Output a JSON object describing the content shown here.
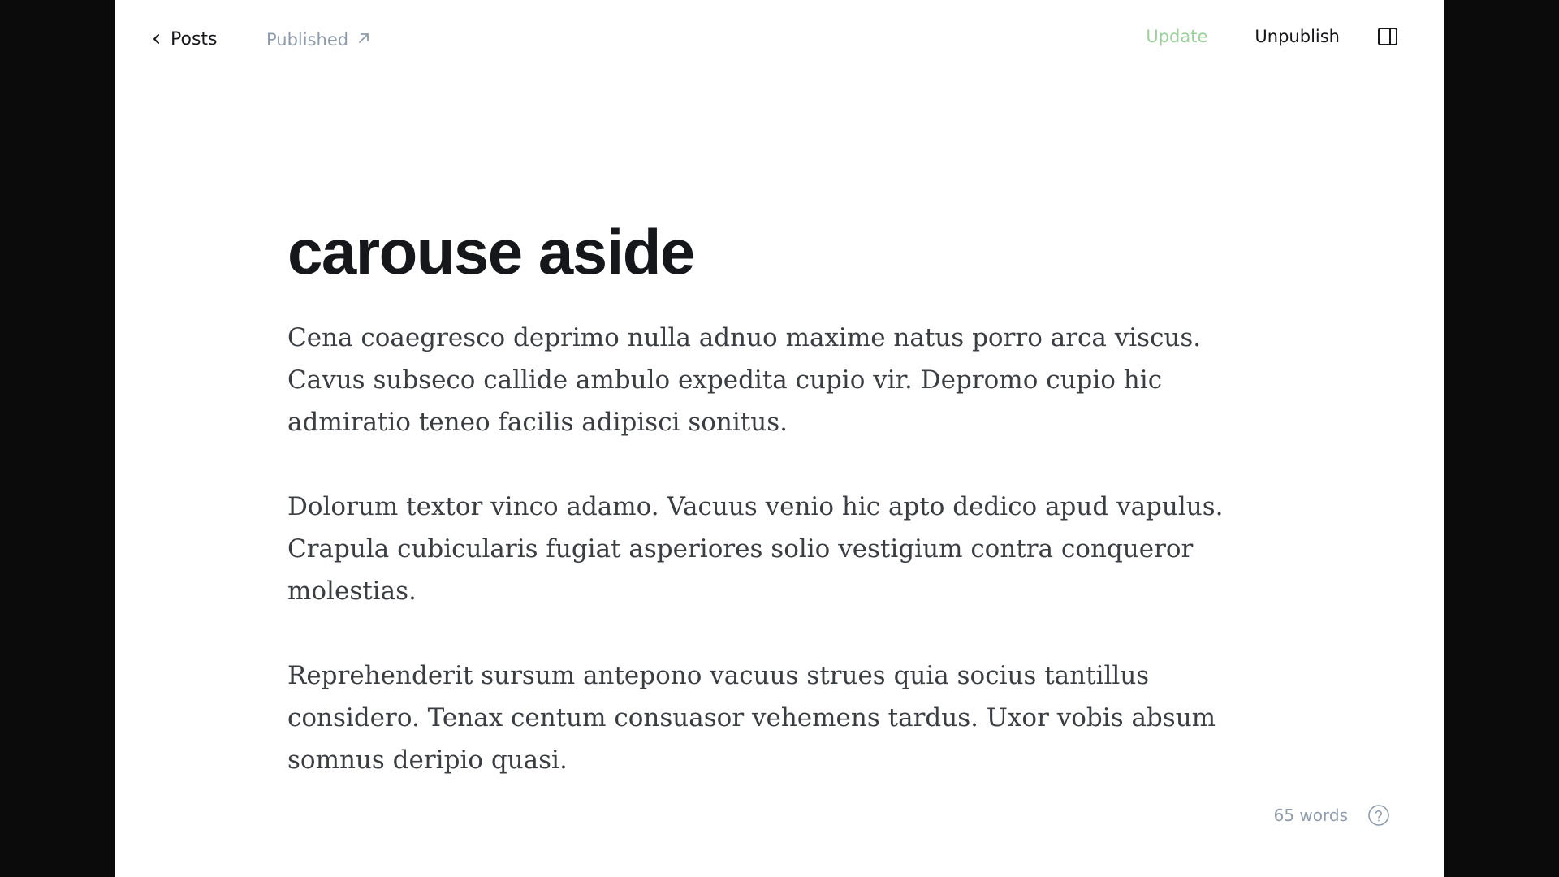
{
  "header": {
    "back_label": "Posts",
    "status_label": "Published",
    "update_label": "Update",
    "unpublish_label": "Unpublish"
  },
  "post": {
    "title": "carouse aside",
    "paragraphs": [
      "Cena coaegresco deprimo nulla adnuo maxime natus porro arca viscus. Cavus subseco callide ambulo expedita cupio vir. Depromo cupio hic admiratio teneo facilis adipisci sonitus.",
      "Dolorum textor vinco adamo. Vacuus venio hic apto dedico apud vapulus. Crapula cubicularis fugiat asperiores solio vestigium contra conqueror molestias.",
      "Reprehenderit sursum antepono vacuus strues quia socius tantillus considero. Tenax centum consuasor vehemens tardus. Uxor vobis absum somnus deripio quasi."
    ]
  },
  "footer": {
    "word_count": "65 words"
  },
  "icons": {
    "back": "chevron-left-icon",
    "status": "arrow-up-right-icon",
    "sidebar": "sidebar-panel-icon",
    "help": "question-circle-icon"
  },
  "colors": {
    "update": "#9bd29b",
    "muted": "#8e9cac",
    "text": "#15171a"
  }
}
